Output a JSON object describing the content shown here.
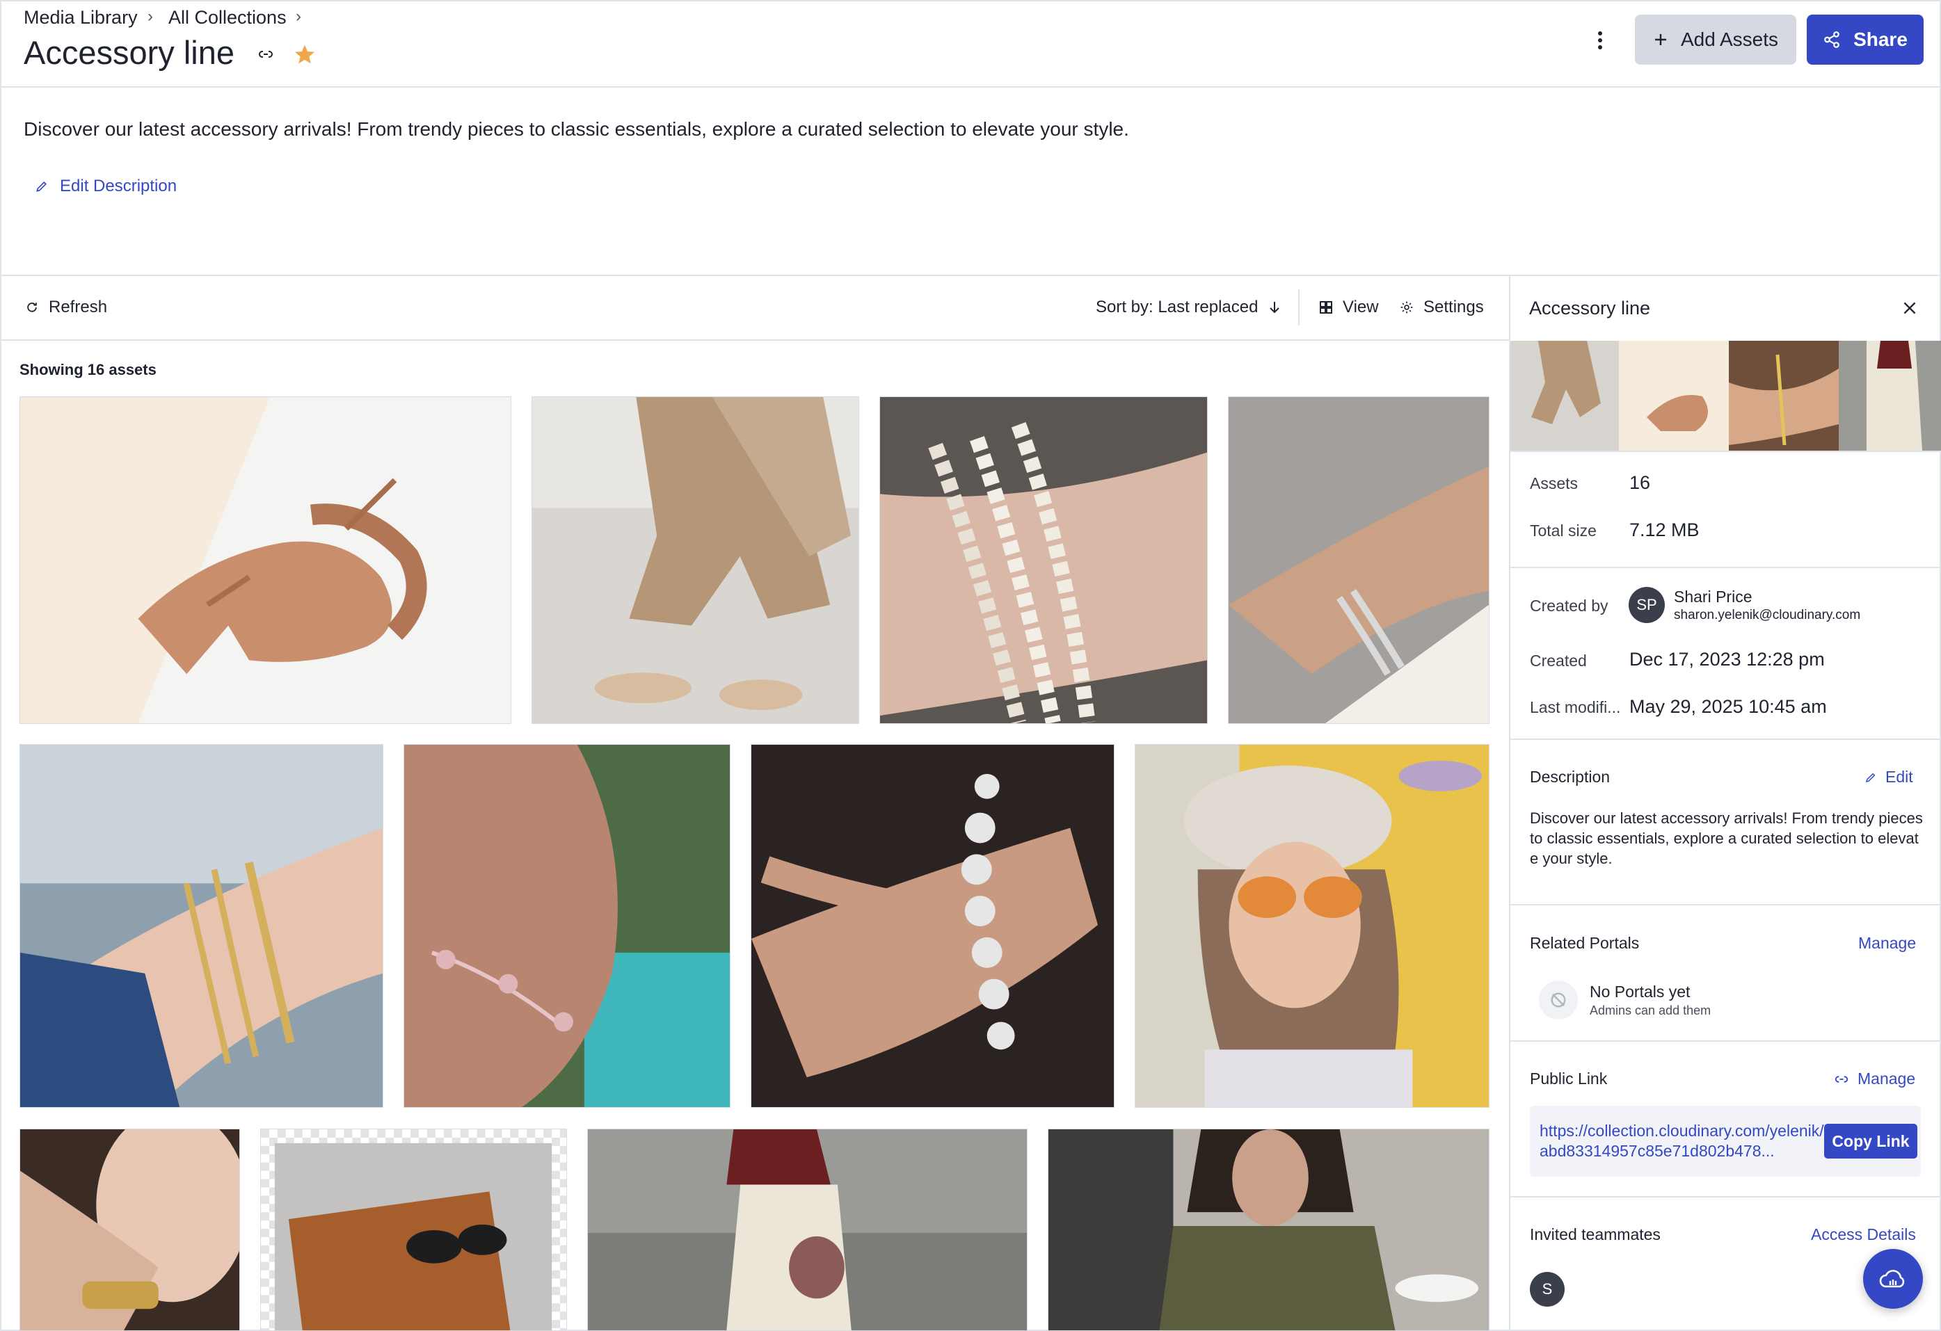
{
  "breadcrumb": {
    "items": [
      "Media Library",
      "All Collections"
    ],
    "separator": "›"
  },
  "header": {
    "title": "Accessory line",
    "add_assets_label": "Add Assets",
    "share_label": "Share",
    "starred": true,
    "star_color": "#f0a64a"
  },
  "description": {
    "text": "Discover our latest accessory arrivals! From trendy pieces to classic essentials, explore a curated selection to elevate your style.",
    "edit_label": "Edit Description"
  },
  "toolbar": {
    "refresh_label": "Refresh",
    "sort_label": "Sort by: Last replaced",
    "view_label": "View",
    "settings_label": "Settings"
  },
  "grid": {
    "showing_label": "Showing 16 assets",
    "assets": [
      {
        "subject": "nude suede pumps"
      },
      {
        "subject": "beige trouser outfit with heels"
      },
      {
        "subject": "three diamond bracelets on wrist"
      },
      {
        "subject": "tennis bracelets on wrist"
      },
      {
        "subject": "gold bracelets on wrist"
      },
      {
        "subject": "rose gold clover bracelet"
      },
      {
        "subject": "diamond cluster bracelet on hand"
      },
      {
        "subject": "woman in beret with sunglasses"
      },
      {
        "subject": "gold cuff on wrist"
      },
      {
        "subject": "brown clutch with sunglasses"
      },
      {
        "subject": "street style with saddle bag"
      },
      {
        "subject": "woman in olive shirt"
      }
    ]
  },
  "panel": {
    "title": "Accessory line",
    "assets_label": "Assets",
    "assets_value": "16",
    "size_label": "Total size",
    "size_value": "7.12 MB",
    "created_by_label": "Created by",
    "creator_initials": "SP",
    "creator_name": "Shari Price",
    "creator_email": "sharon.yelenik@cloudinary.com",
    "created_label": "Created",
    "created_value": "Dec 17, 2023 12:28 pm",
    "modified_label": "Last modifi...",
    "modified_value": "May 29, 2025 10:45 am",
    "description_label": "Description",
    "description_edit": "Edit",
    "description_text": "Discover our latest accessory arrivals! From trendy pieces to classic essentials, explore a curated selection to elevate your style.",
    "portals_label": "Related Portals",
    "portals_manage": "Manage",
    "no_portals": "No Portals yet",
    "no_portals_sub": "Admins can add them",
    "public_link_label": "Public Link",
    "public_link_manage": "Manage",
    "public_link_url": "https://collection.cloudinary.com/yelenik/abd83314957c85e71d802b478...",
    "copy_link_label": "Copy Link",
    "invited_label": "Invited teammates",
    "access_details_label": "Access Details",
    "teammate_initial": "S"
  },
  "colors": {
    "accent": "#3448c5",
    "border": "#e1e3ea"
  }
}
